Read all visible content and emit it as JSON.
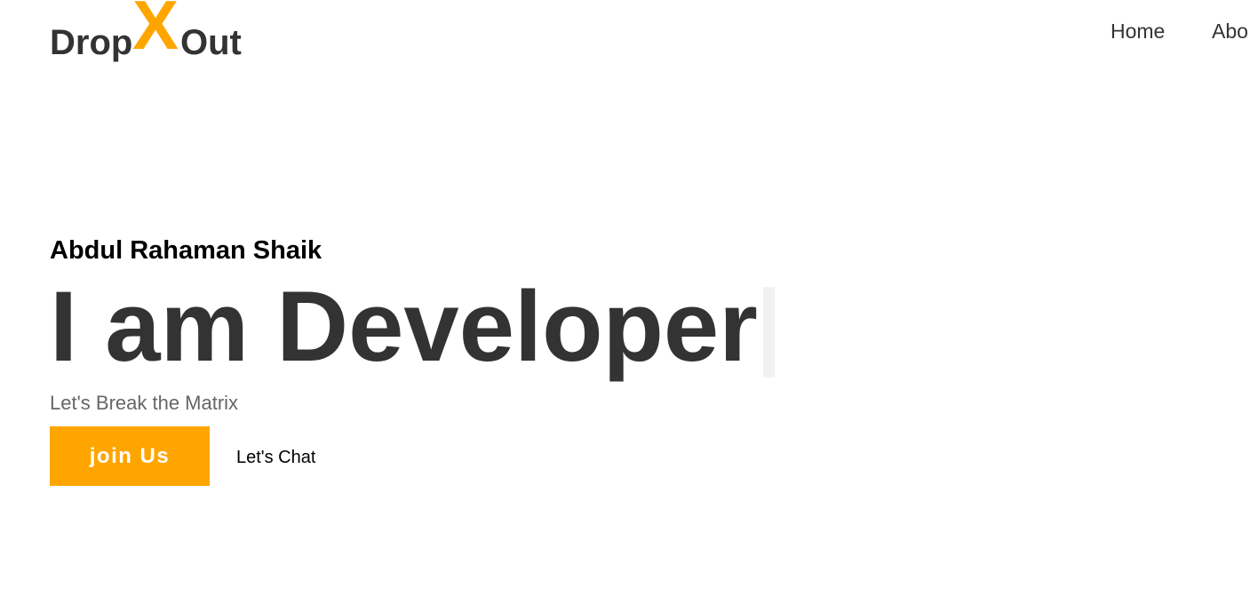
{
  "logo": {
    "part1": "Drop",
    "part2": "X",
    "part3": "Out",
    "accent_color": "#FFA500",
    "text_color": "#333333"
  },
  "nav": {
    "items": [
      {
        "label": "Home"
      },
      {
        "label": "Abo"
      }
    ]
  },
  "hero": {
    "name": "Abdul Rahaman Shaik",
    "title": "I am Developer",
    "tagline": "Let's Break the Matrix",
    "primary_button": "join Us",
    "secondary_link": "Let's Chat"
  },
  "colors": {
    "accent": "#FFA500",
    "heading": "#333333",
    "muted": "#666666",
    "background": "#ffffff"
  }
}
